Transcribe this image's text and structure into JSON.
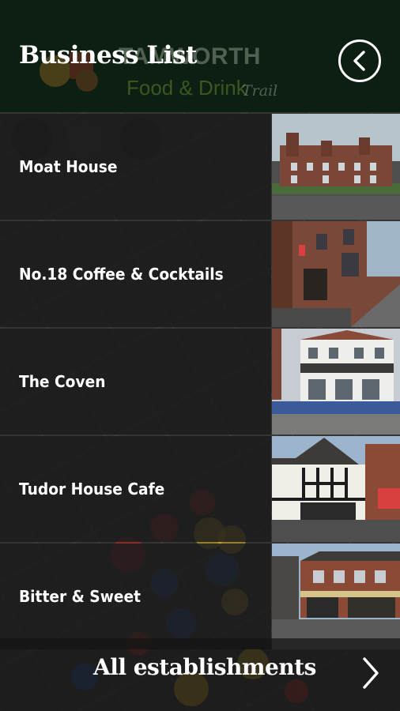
{
  "header": {
    "title": "Business List",
    "brand_name": "TAMWORTH",
    "brand_subtitle": "Food & Drink",
    "brand_trail": "Trail",
    "back_icon": "back-circle-icon"
  },
  "businesses": [
    {
      "name": "Moat House",
      "thumb_icon": "building-photo"
    },
    {
      "name": "No.18 Coffee & Cocktails",
      "thumb_icon": "building-photo"
    },
    {
      "name": "The Coven",
      "thumb_icon": "building-photo"
    },
    {
      "name": "Tudor House Cafe",
      "thumb_icon": "building-photo"
    },
    {
      "name": "Bitter & Sweet",
      "thumb_icon": "building-photo"
    }
  ],
  "footer": {
    "label": "All establishments",
    "chevron_icon": "chevron-right-icon"
  },
  "colors": {
    "header_bg": "#0c1f12",
    "text": "#ffffff",
    "brand_green": "#8fbf3a"
  }
}
